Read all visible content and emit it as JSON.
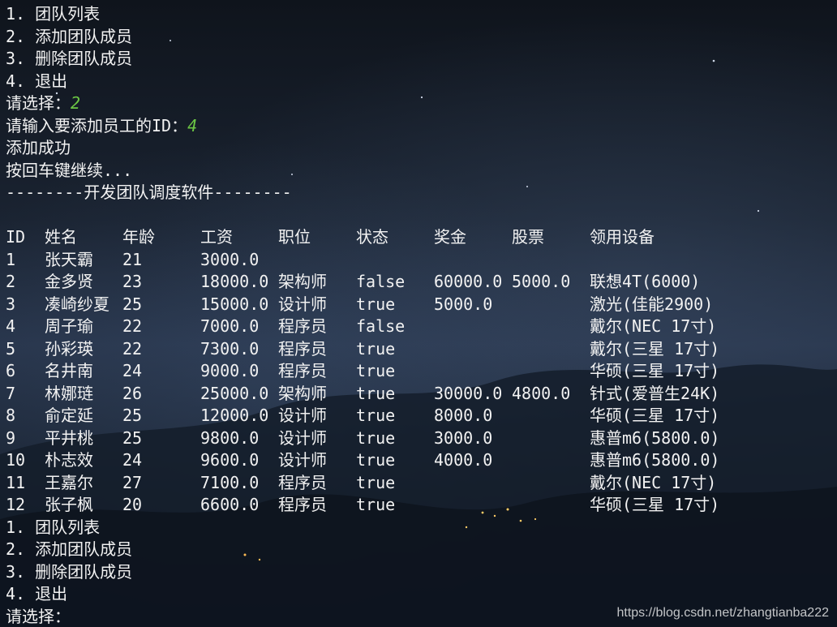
{
  "menu_top": {
    "items": [
      "1. 团队列表",
      "2. 添加团队成员",
      "3. 删除团队成员",
      "4. 退出"
    ],
    "prompt": "请选择：",
    "choice": "2"
  },
  "add_flow": {
    "id_prompt": "请输入要添加员工的ID：",
    "id_value": "4",
    "success": "添加成功",
    "continue": "按回车键继续..."
  },
  "banner": "--------开发团队调度软件--------",
  "table": {
    "headers": [
      "ID",
      "姓名",
      "年龄",
      "工资",
      "职位",
      "状态",
      "奖金",
      "股票",
      "领用设备"
    ],
    "rows": [
      [
        "1",
        "张天霸",
        "21",
        "3000.0",
        "",
        "",
        "",
        "",
        ""
      ],
      [
        "2",
        "金多贤",
        "23",
        "18000.0",
        "架构师",
        "false",
        "60000.0",
        "5000.0",
        "联想4T(6000)"
      ],
      [
        "3",
        "凑崎纱夏",
        "25",
        "15000.0",
        "设计师",
        "true",
        "5000.0",
        "",
        "激光(佳能2900)"
      ],
      [
        "4",
        "周子瑜",
        "22",
        "7000.0",
        "程序员",
        "false",
        "",
        "",
        "戴尔(NEC 17寸)"
      ],
      [
        "5",
        "孙彩瑛",
        "22",
        "7300.0",
        "程序员",
        "true",
        "",
        "",
        "戴尔(三星 17寸)"
      ],
      [
        "6",
        "名井南",
        "24",
        "9000.0",
        "程序员",
        "true",
        "",
        "",
        "华硕(三星 17寸)"
      ],
      [
        "7",
        "林娜琏",
        "26",
        "25000.0",
        "架构师",
        "true",
        "30000.0",
        "4800.0",
        "针式(爱普生24K)"
      ],
      [
        "8",
        "俞定延",
        "25",
        "12000.0",
        "设计师",
        "true",
        "8000.0",
        "",
        "华硕(三星 17寸)"
      ],
      [
        "9",
        "平井桃",
        "25",
        "9800.0",
        "设计师",
        "true",
        "3000.0",
        "",
        "惠普m6(5800.0)"
      ],
      [
        "10",
        "朴志效",
        "24",
        "9600.0",
        "设计师",
        "true",
        "4000.0",
        "",
        "惠普m6(5800.0)"
      ],
      [
        "11",
        "王嘉尔",
        "27",
        "7100.0",
        "程序员",
        "true",
        "",
        "",
        "戴尔(NEC 17寸)"
      ],
      [
        "12",
        "张子枫",
        "20",
        "6600.0",
        "程序员",
        "true",
        "",
        "",
        "华硕(三星 17寸)"
      ]
    ]
  },
  "menu_bottom": {
    "items": [
      "1. 团队列表",
      "2. 添加团队成员",
      "3. 删除团队成员",
      "4. 退出"
    ],
    "prompt": "请选择："
  },
  "watermark": "https://blog.csdn.net/zhangtianba222",
  "colors": {
    "text": "#f2f2f2",
    "input": "#6cc644",
    "background": "#141b26"
  }
}
